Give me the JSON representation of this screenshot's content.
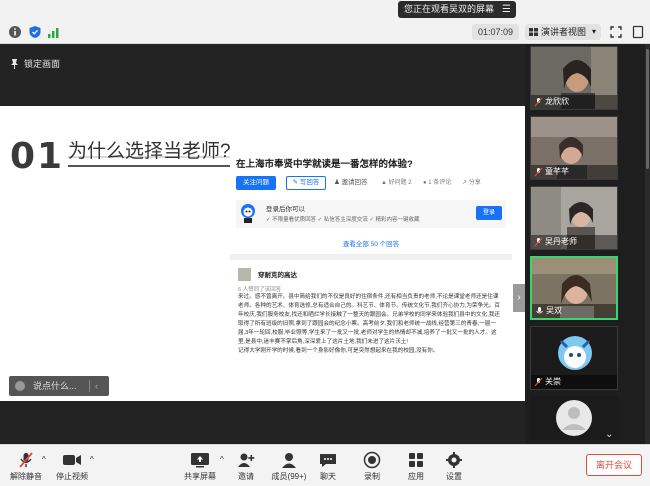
{
  "banner": {
    "viewing_text": "您正在观看吴双的屏幕",
    "menu_glyph": "☰"
  },
  "toolbar": {
    "timer": "01:07:09",
    "view_label": "演讲者视图",
    "view_arrow": "▾"
  },
  "stage": {
    "lock_label": "锁定画面",
    "slide_number": "01",
    "slide_title": "为什么选择当老师?",
    "say_placeholder": "说点什么...",
    "collapse_glyph": "›"
  },
  "web": {
    "question": "在上海市奉贤中学就读是一番怎样的体验?",
    "follow_label": "关注问题",
    "write_label": "✎ 写回答",
    "invite_label": "♟ 邀请回答",
    "meta": [
      "▲ 好问题 2",
      "● 1 条评论",
      "↗ 分享"
    ],
    "login_title": "登录后你可以",
    "login_features": "✓ 不限量看优质回答   ✓ 私信答主深度交流   ✓ 精彩内容一键收藏",
    "login_button": "登录",
    "more_answers": "查看全部 50 个回答",
    "author": "穿耐克的高达",
    "votes": "6 人赞同了该回答",
    "answer": "来过。感不曾离开。县中简给我们的不仅是良好的住宿条件,还有相当负责的老师,不论是课堂老师还是住课老师。各种的艺术、体育选修,总有适合自己的。科艺节、体育节、传统文化节,我们齐心协力,为荣争光。百年校庆,我们服务校友,找还和晒烂学长接触了一整天的跟园会。兄弟学校的同学来体验我们县中的文化,我还取得了所有班级的旧照,拿到了跟园会的纪念小票。高考前夕,我们和老师统一战线,经营第三的青春,一届一届,3年一轮回,校服,毕业照等,学生来了一批又一批,老师对学生的热情却不减,培养了一批又一批的人才。这里,是县中,迷丰赛不掌后角,深深爱上了这片土地,我们未进了这片沃土!\n记得大学刚开学的时候,看到一个身影好像你,可是突然想起来在我的校园,没有你。"
  },
  "participants": [
    {
      "name": "龙欣欣",
      "bg": "#6a6a62"
    },
    {
      "name": "童芊芊",
      "bg": "#7a7068"
    },
    {
      "name": "吴丹老师",
      "bg": "#8a8680"
    },
    {
      "name": "吴双",
      "bg": "#7d7362"
    },
    {
      "name": "关崇",
      "bg": "#1b1b1b"
    },
    {
      "name": "",
      "bg": "#1b1b1b"
    }
  ],
  "participants_more": "⌄",
  "bottom": {
    "mute": "解除静音",
    "video": "停止视频",
    "share": "共享屏幕",
    "invite": "邀请",
    "members": "成员(99+)",
    "chat": "聊天",
    "record": "录制",
    "apps": "应用",
    "settings": "设置",
    "leave": "离开会议",
    "caret": "^"
  },
  "colors": {
    "accent": "#1772f6",
    "active_border": "#3bd46f",
    "leave": "#e3493c"
  }
}
